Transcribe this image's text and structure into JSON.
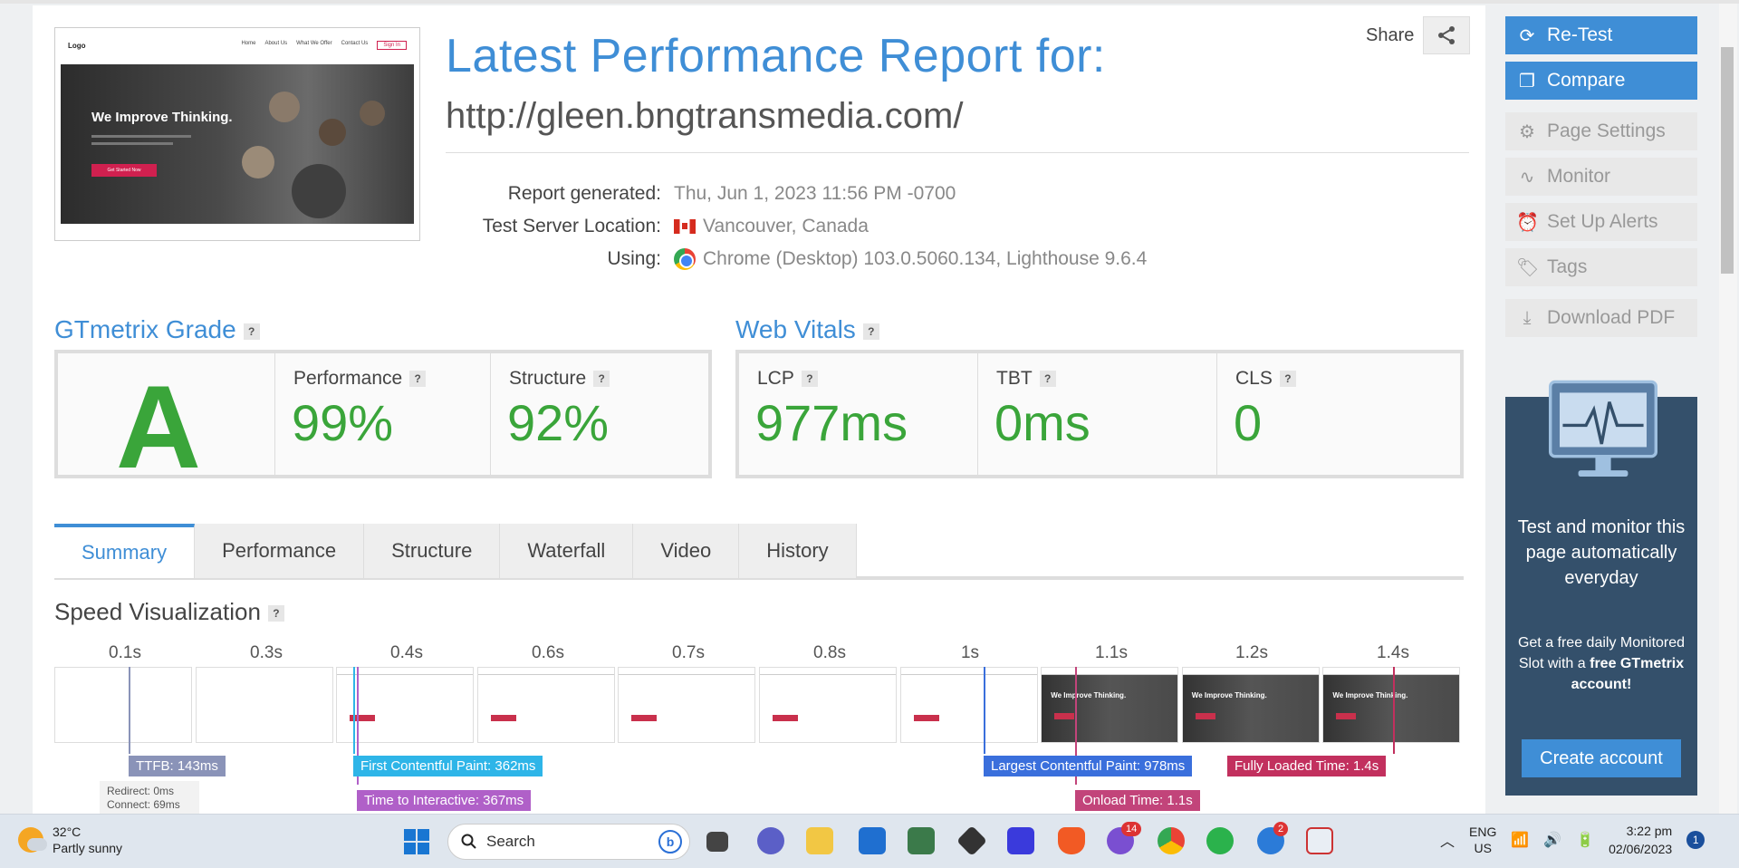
{
  "header": {
    "title": "Latest Performance Report for:",
    "url": "http://gleen.bngtransmedia.com/",
    "share_label": "Share",
    "meta": [
      {
        "label": "Report generated:",
        "value": "Thu, Jun 1, 2023 11:56 PM -0700"
      },
      {
        "label": "Test Server Location:",
        "value": "Vancouver, Canada"
      },
      {
        "label": "Using:",
        "value": "Chrome (Desktop) 103.0.5060.134, Lighthouse 9.6.4"
      }
    ]
  },
  "thumbnail": {
    "logo": "Logo",
    "links": [
      "Home",
      "About Us",
      "What We Offer",
      "Contact Us"
    ],
    "signin": "Sign In",
    "headline": "We Improve Thinking.",
    "cta": "Get Started Now"
  },
  "grade": {
    "title": "GTmetrix Grade",
    "help": "?",
    "letter": "A",
    "performance_label": "Performance",
    "performance_value": "99%",
    "structure_label": "Structure",
    "structure_value": "92%"
  },
  "vitals": {
    "title": "Web Vitals",
    "help": "?",
    "items": [
      {
        "label": "LCP",
        "value": "977ms"
      },
      {
        "label": "TBT",
        "value": "0ms"
      },
      {
        "label": "CLS",
        "value": "0"
      }
    ]
  },
  "tabs": [
    "Summary",
    "Performance",
    "Structure",
    "Waterfall",
    "Video",
    "History"
  ],
  "speed": {
    "title": "Speed Visualization",
    "help": "?",
    "times": [
      "0.1s",
      "0.3s",
      "0.4s",
      "0.6s",
      "0.7s",
      "0.8s",
      "1s",
      "1.1s",
      "1.2s",
      "1.4s"
    ],
    "frame_headline": "We Improve Thinking.",
    "markers": {
      "ttfb": "TTFB: 143ms",
      "redirect": "Redirect: 0ms",
      "connect": "Connect: 69ms",
      "fcp": "First Contentful Paint: 362ms",
      "tti": "Time to Interactive: 367ms",
      "lcp": "Largest Contentful Paint: 978ms",
      "onload": "Onload Time: 1.1s",
      "fully": "Fully Loaded Time: 1.4s"
    }
  },
  "sidebar": {
    "buttons": [
      {
        "label": "Re-Test",
        "icon": "refresh-icon",
        "style": "blue"
      },
      {
        "label": "Compare",
        "icon": "copy-icon",
        "style": "blue"
      },
      {
        "label": "Page Settings",
        "icon": "gear-icon",
        "style": "grey"
      },
      {
        "label": "Monitor",
        "icon": "pulse-icon",
        "style": "grey"
      },
      {
        "label": "Set Up Alerts",
        "icon": "alarm-icon",
        "style": "grey"
      },
      {
        "label": "Tags",
        "icon": "tag-icon",
        "style": "grey"
      },
      {
        "label": "Download PDF",
        "icon": "pdf-icon",
        "style": "grey"
      }
    ],
    "promo_text": "Test and monitor this page automatically everyday",
    "promo_sub_1": "Get a free daily Monitored Slot with a ",
    "promo_sub_bold": "free GTmetrix account!",
    "promo_cta": "Create account"
  },
  "taskbar": {
    "temp": "32°C",
    "weather": "Partly sunny",
    "search": "Search",
    "lang1": "ENG",
    "lang2": "US",
    "time": "3:22 pm",
    "date": "02/06/2023",
    "viber_badge": "14",
    "thunderbird_badge": "2",
    "notif_badge": "1"
  },
  "colors": {
    "accent": "#3f8ed6",
    "grade_green": "#3aa53a",
    "ttfb": "#8a93b8",
    "fcp": "#2eb5e8",
    "tti": "#b060c8",
    "lcp": "#3a6fdc",
    "onload": "#c2447a",
    "fully": "#c2305e"
  }
}
